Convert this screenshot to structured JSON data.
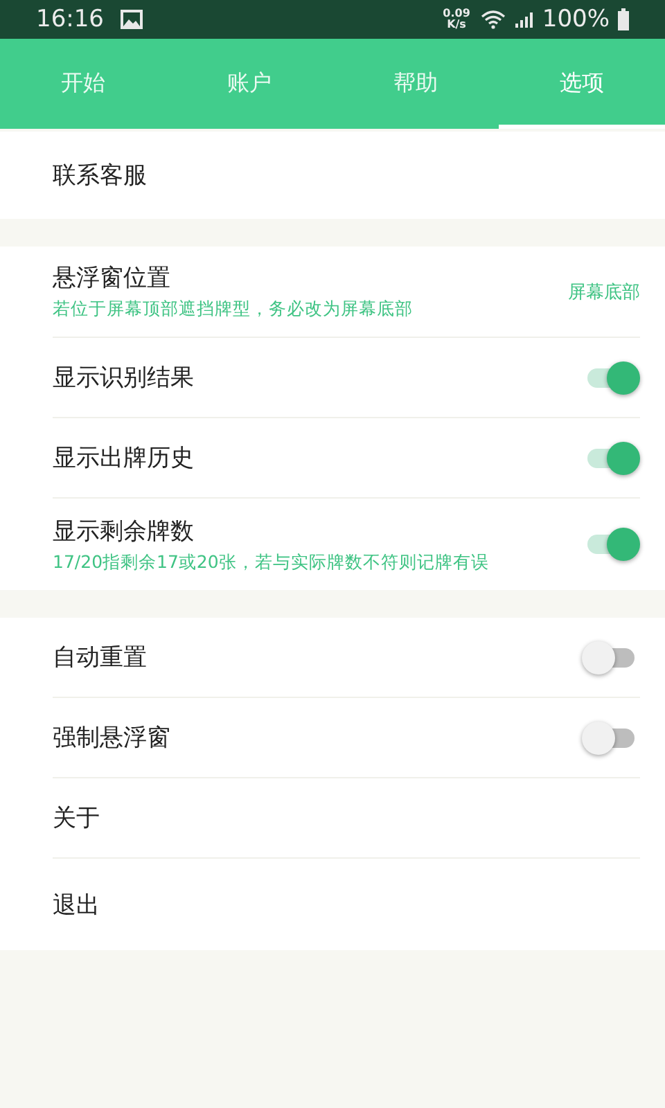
{
  "status_bar": {
    "time": "16:16",
    "speed_value": "0.09",
    "speed_unit": "K/s",
    "battery": "100%"
  },
  "tabs": [
    {
      "label": "开始",
      "selected": false
    },
    {
      "label": "账户",
      "selected": false
    },
    {
      "label": "帮助",
      "selected": false
    },
    {
      "label": "选项",
      "selected": true
    }
  ],
  "sections": [
    {
      "items": [
        {
          "kind": "link",
          "title": "联系客服"
        }
      ]
    },
    {
      "items": [
        {
          "kind": "value",
          "title": "悬浮窗位置",
          "subtitle": "若位于屏幕顶部遮挡牌型，务必改为屏幕底部",
          "value": "屏幕底部"
        },
        {
          "kind": "toggle",
          "title": "显示识别结果",
          "on": true
        },
        {
          "kind": "toggle",
          "title": "显示出牌历史",
          "on": true
        },
        {
          "kind": "toggle",
          "title": "显示剩余牌数",
          "subtitle": "17/20指剩余17或20张，若与实际牌数不符则记牌有误",
          "on": true
        }
      ]
    },
    {
      "items": [
        {
          "kind": "toggle",
          "title": "自动重置",
          "on": false
        },
        {
          "kind": "toggle",
          "title": "强制悬浮窗",
          "on": false
        },
        {
          "kind": "link",
          "title": "关于"
        },
        {
          "kind": "link",
          "title": "退出"
        }
      ]
    }
  ]
}
